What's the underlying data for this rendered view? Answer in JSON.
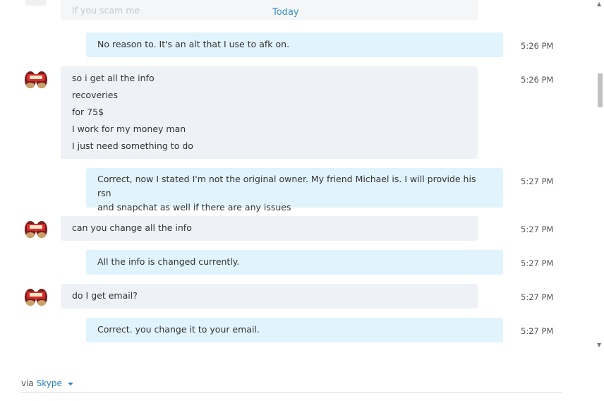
{
  "conversation": {
    "faded_message": "If you scam me",
    "date_separator": "Today",
    "messages": [
      {
        "side": "outgoing",
        "lines": [
          "No reason to. It's an alt that I use to afk on."
        ],
        "time": "5:26 PM"
      },
      {
        "side": "incoming",
        "lines": [
          "so i get all the info",
          "recoveries",
          "for 75$",
          "I work for my money man",
          "I just need something to do"
        ],
        "time": "5:26 PM"
      },
      {
        "side": "outgoing",
        "lines": [
          "Correct, now I stated I'm not the original owner. My friend Michael is. I will provide his rsn",
          "and snapchat as well if there are any issues"
        ],
        "time": "5:27 PM"
      },
      {
        "side": "incoming",
        "lines": [
          "can you change all the info"
        ],
        "time": "5:27 PM"
      },
      {
        "side": "outgoing",
        "lines": [
          "All the info is changed currently."
        ],
        "time": "5:27 PM"
      },
      {
        "side": "incoming",
        "lines": [
          "do I get email?"
        ],
        "time": "5:27 PM"
      },
      {
        "side": "outgoing",
        "lines": [
          "Correct. you change it to your email."
        ],
        "time": "5:27 PM"
      }
    ]
  },
  "footer": {
    "via_label": "via",
    "service_label": "Skype"
  },
  "colors": {
    "incoming_bubble": "#eef1f5",
    "outgoing_bubble": "#e1f3fc",
    "accent": "#2a7fc0"
  },
  "icons": {
    "avatar": "snack-pudding-cups-avatar",
    "service_dropdown": "caret-down-icon"
  }
}
